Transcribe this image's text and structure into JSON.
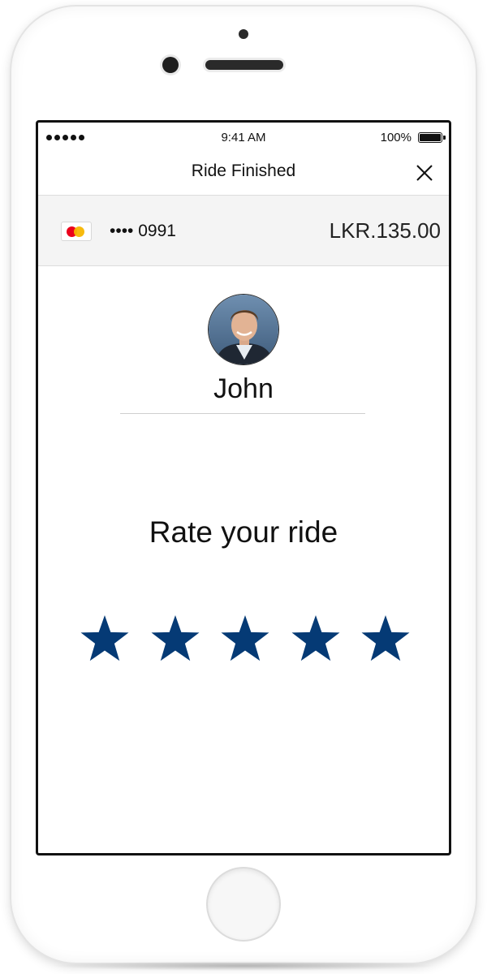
{
  "status_bar": {
    "time": "9:41 AM",
    "battery_percent": "100%",
    "signal_icon": "signal-dots-icon",
    "battery_icon": "battery-icon"
  },
  "nav": {
    "title": "Ride Finished",
    "close_icon": "close-icon"
  },
  "payment": {
    "card_icon": "mastercard-icon",
    "card_number": "•••• 0991",
    "amount": "LKR.135.00"
  },
  "driver": {
    "name": "John",
    "avatar_icon": "driver-avatar"
  },
  "rating": {
    "prompt": "Rate your ride",
    "max_stars": 5,
    "star_color": "#053a75",
    "star_icon": "star-icon"
  },
  "colors": {
    "screen_bg": "#ffffff",
    "payment_bg": "#f4f4f4",
    "star": "#053a75",
    "text": "#111111"
  }
}
